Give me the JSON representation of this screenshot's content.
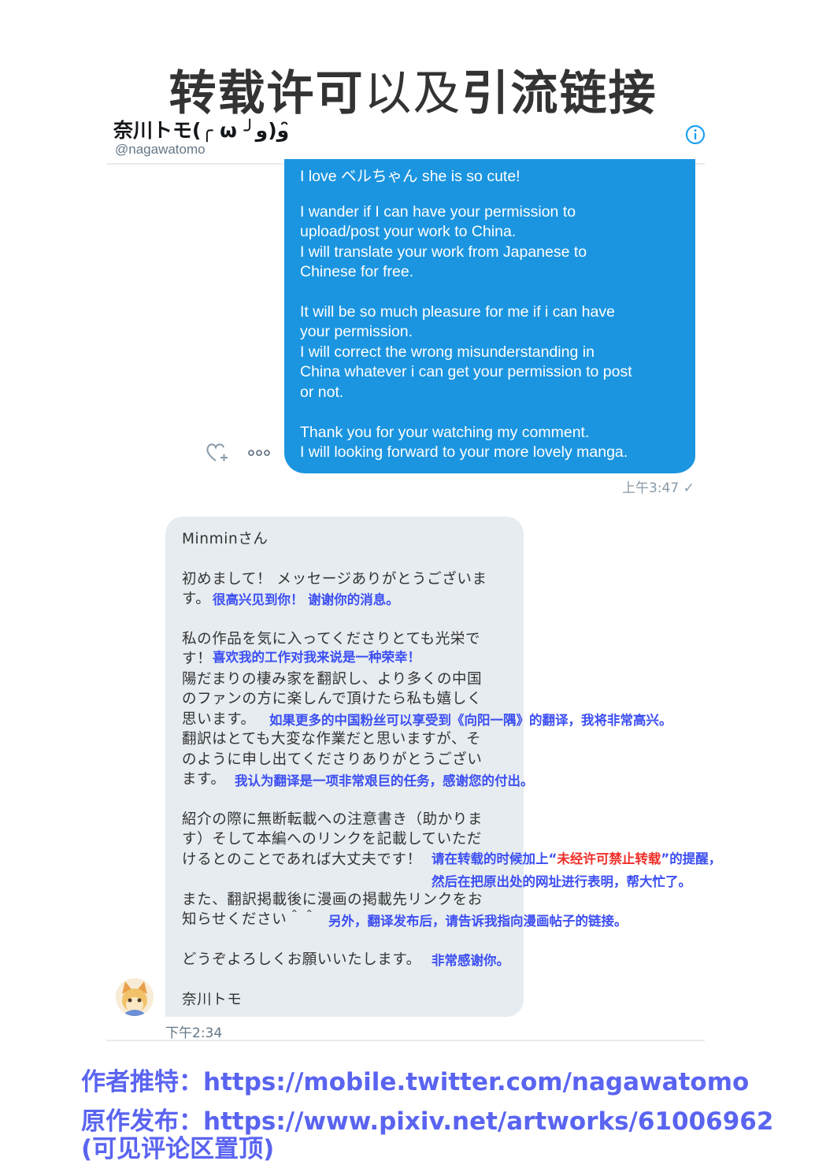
{
  "page": {
    "title_bold_a": "转载许可",
    "title_light": "以及",
    "title_bold_b": "引流链接"
  },
  "header": {
    "display_name": "奈川トモ(╭ ω ╯و)و ̑̑",
    "handle": "@nagawatomo",
    "info_icon": "info-icon"
  },
  "sent_message": {
    "lines": [
      "I love ベルちゃん she is so cute!",
      "I wander if I can have your  permission to",
      "upload/post your work to China.",
      "I will translate your work from Japanese to",
      "Chinese  for free.",
      "It will be so much pleasure for me if i can have",
      "your permission.",
      "I will correct the wrong misunderstanding in",
      "China whatever i can get your permission to post",
      "or not.",
      "Thank you for your watching my comment.",
      "I will looking forward to your more lovely manga."
    ],
    "timestamp": "上午3:47 ✓",
    "actions": [
      "heart-plus-icon",
      "more-icon"
    ],
    "bubble_color": "#1b95e0"
  },
  "received_message": {
    "jp_lines": [
      "Minminさん",
      "初めまして！ メッセージありがとうございま",
      "す。",
      "私の作品を気に入ってくださりとても光栄で",
      "す！",
      "陽だまりの棲み家を翻訳し、より多くの中国",
      "のファンの方に楽しんで頂けたら私も嬉しく",
      "思います。",
      "翻訳はとても大変な作業だと思いますが、そ",
      "のように申し出てくださりありがとうござい",
      "ます。",
      "紹介の際に無断転載への注意書き（助かりま",
      "す）そして本編へのリンクを記載していただ",
      "けるとのことであれば大丈夫です！",
      "また、翻訳掲載後に漫画の掲載先リンクをお",
      "知らせください＾＾",
      "どうぞよろしくお願いいたします。",
      "奈川トモ"
    ],
    "cn_notes": {
      "n1": "很高兴见到你！ 谢谢你的消息。",
      "n2": "喜欢我的工作对我来说是一种荣幸！",
      "n3": "如果更多的中国粉丝可以享受到《向阳一隅》的翻译，我将非常高兴。",
      "n4": "我认为翻译是一项非常艰巨的任务，感谢您的付出。",
      "n5_a": "请在转载的时候加上“",
      "n5_warn": "未经许可禁止转载",
      "n5_b": "”的提醒，",
      "n6": "然后在把原出处的网址进行表明，帮大忙了。",
      "n7": "另外，翻译发布后，请告诉我指向漫画帖子的链接。",
      "n8": "非常感谢你。"
    },
    "timestamp": "下午2:34",
    "bubble_color": "#e6ecf0"
  },
  "credits": {
    "twitter": "作者推特：https://mobile.twitter.com/nagawatomo",
    "pixiv": "原作发布：https://www.pixiv.net/artworks/61006962",
    "pixiv_note": "(可见评论区置顶)"
  },
  "colors": {
    "note_blue": "#3d4ff2",
    "note_red": "#f0302a",
    "credit_blue": "#5a64f0"
  }
}
